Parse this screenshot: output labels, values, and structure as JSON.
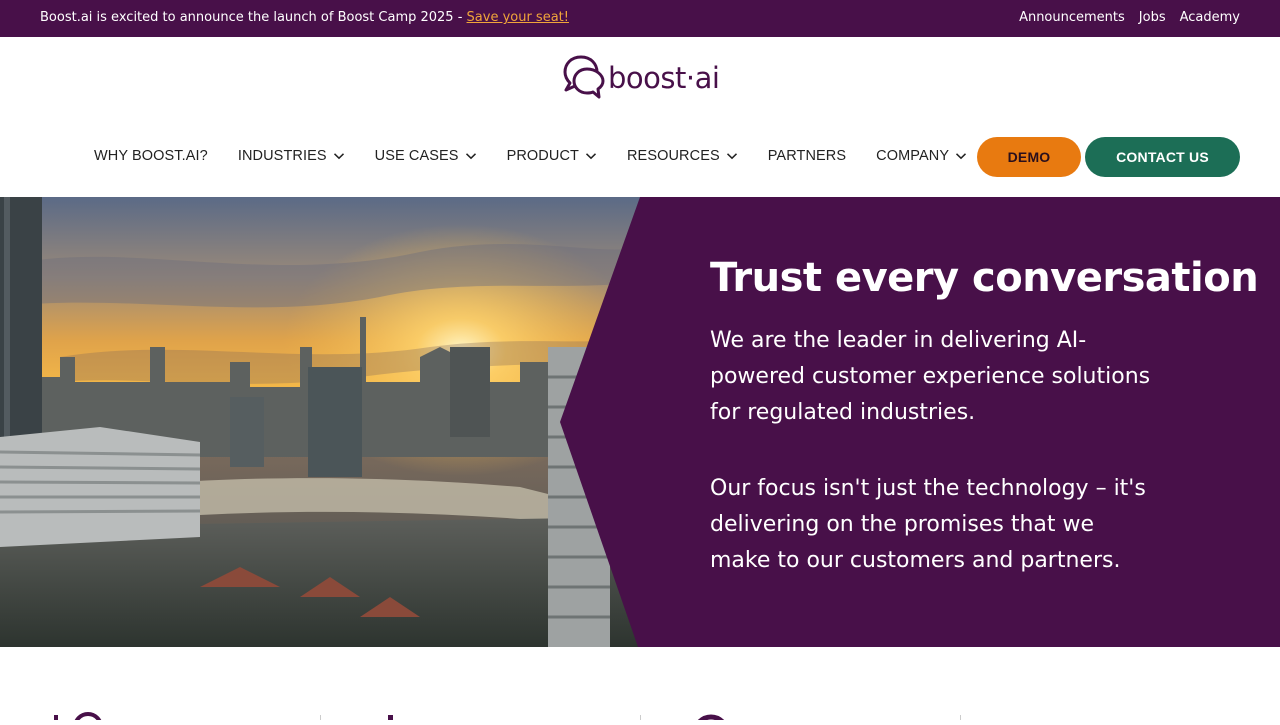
{
  "announcement": {
    "text": "Boost.ai is excited to announce the launch of Boost Camp 2025 - ",
    "link": "Save your seat!"
  },
  "top_links": [
    "Announcements",
    "Jobs",
    "Academy"
  ],
  "logo": {
    "text": "boost·ai"
  },
  "nav": {
    "items": [
      {
        "label": "WHY BOOST.AI?",
        "dropdown": false
      },
      {
        "label": "INDUSTRIES",
        "dropdown": true
      },
      {
        "label": "USE CASES",
        "dropdown": true
      },
      {
        "label": "PRODUCT",
        "dropdown": true
      },
      {
        "label": "RESOURCES",
        "dropdown": true
      },
      {
        "label": "PARTNERS",
        "dropdown": false
      },
      {
        "label": "COMPANY",
        "dropdown": true
      }
    ],
    "demo_label": "DEMO",
    "contact_label": "CONTACT US"
  },
  "hero": {
    "title": "Trust every conversation",
    "paragraph1": "We are the leader in delivering AI-powered customer experience solutions for regulated industries.",
    "paragraph2": "Our focus isn't just the technology – it's delivering on the promises that we make to our customers and partners."
  },
  "colors": {
    "brand_purple": "#481049",
    "demo_orange": "#e87a10",
    "contact_green": "#1c6e56",
    "link_orange": "#f0a53a"
  }
}
